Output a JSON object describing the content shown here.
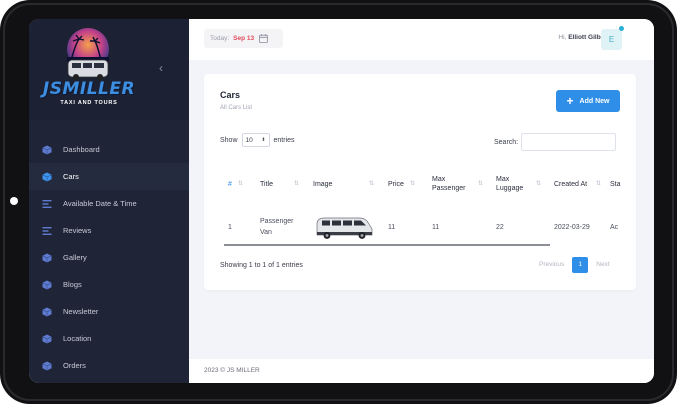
{
  "brand": {
    "name": "JSMILLER",
    "tagline": "TAXI AND TOURS"
  },
  "sidebar": {
    "items": [
      {
        "label": "Dashboard",
        "icon": "cube-icon",
        "active": false
      },
      {
        "label": "Cars",
        "icon": "cube-icon",
        "active": true
      },
      {
        "label": "Available Date & Time",
        "icon": "list-icon",
        "active": false
      },
      {
        "label": "Reviews",
        "icon": "list-icon",
        "active": false
      },
      {
        "label": "Gallery",
        "icon": "cube-icon",
        "active": false
      },
      {
        "label": "Blogs",
        "icon": "cube-icon",
        "active": false
      },
      {
        "label": "Newsletter",
        "icon": "cube-icon",
        "active": false
      },
      {
        "label": "Location",
        "icon": "cube-icon",
        "active": false
      },
      {
        "label": "Orders",
        "icon": "cube-icon",
        "active": false
      }
    ]
  },
  "topbar": {
    "date_label": "Today:",
    "date_value": "Sep 13",
    "greeting_prefix": "Hi,",
    "user_name": "Elliott Gilbert",
    "avatar_letter": "E"
  },
  "card": {
    "title": "Cars",
    "subtitle": "All Cars List",
    "add_button": "Add New",
    "show_prefix": "Show",
    "entries_value": "10",
    "show_suffix": "entries",
    "search_label": "Search:",
    "search_value": ""
  },
  "table": {
    "columns": [
      "#",
      "Title",
      "Image",
      "Price",
      "Max Passenger",
      "Max Luggage",
      "Created At",
      "Sta"
    ],
    "rows": [
      {
        "num": "1",
        "title": "Passenger Van",
        "price": "11",
        "max_passenger": "11",
        "max_luggage": "22",
        "created_at": "2022-03-29",
        "status": "Ac"
      }
    ]
  },
  "pagination": {
    "info": "Showing 1 to 1 of 1 entries",
    "previous": "Previous",
    "current": "1",
    "next": "Next"
  },
  "footer": {
    "text": "2023 ©   JS MILLER"
  },
  "colors": {
    "accent": "#2f8ee8",
    "sidebar": "#1f2537",
    "date_highlight": "#e04b5a"
  }
}
